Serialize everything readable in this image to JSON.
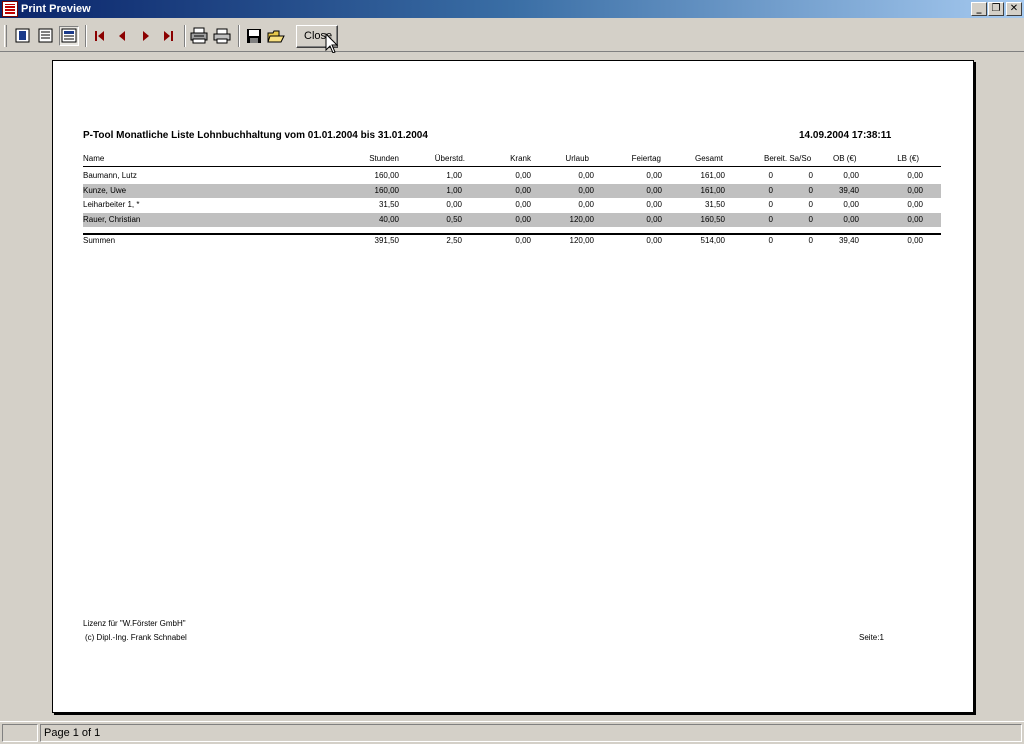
{
  "window": {
    "title": "Print Preview"
  },
  "toolbar": {
    "close_label": "Close"
  },
  "report": {
    "title": "P-Tool   Monatliche Liste Lohnbuchhaltung vom 01.01.2004  bis 31.01.2004",
    "datetime": "14.09.2004 17:38:11",
    "columns": [
      "Name",
      "Stunden",
      "Überstd.",
      "Krank",
      "Urlaub",
      "Feiertag",
      "Gesamt",
      "Bereit. Sa/So",
      "OB (€)",
      "LB (€)"
    ],
    "rows": [
      [
        "Baumann, Lutz",
        "160,00",
        "1,00",
        "0,00",
        "0,00",
        "0,00",
        "161,00",
        "0",
        "0",
        "0,00",
        "0,00"
      ],
      [
        "Kunze, Uwe",
        "160,00",
        "1,00",
        "0,00",
        "0,00",
        "0,00",
        "161,00",
        "0",
        "0",
        "39,40",
        "0,00"
      ],
      [
        "Leiharbeiter 1, *",
        "31,50",
        "0,00",
        "0,00",
        "0,00",
        "0,00",
        "31,50",
        "0",
        "0",
        "0,00",
        "0,00"
      ],
      [
        "Rauer, Christian",
        "40,00",
        "0,50",
        "0,00",
        "120,00",
        "0,00",
        "160,50",
        "0",
        "0",
        "0,00",
        "0,00"
      ]
    ],
    "totals": [
      "Summen",
      "391,50",
      "2,50",
      "0,00",
      "120,00",
      "0,00",
      "514,00",
      "0",
      "0",
      "39,40",
      "0,00"
    ],
    "footer": {
      "license": "Lizenz für \"W.Förster GmbH\"",
      "copyright": "(c) Dipl.-Ing. Frank Schnabel",
      "page": "Seite:1"
    }
  },
  "status": {
    "page_info": "Page 1 of 1"
  }
}
